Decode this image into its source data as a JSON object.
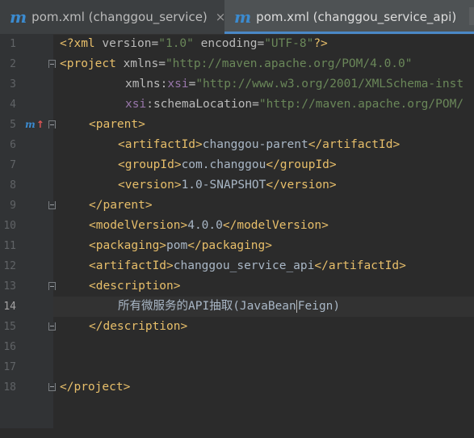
{
  "tabs": [
    {
      "label": "pom.xml (changgou_service)",
      "icon": "maven-icon",
      "close": "×",
      "active": false
    },
    {
      "label": "pom.xml (changgou_service_api)",
      "icon": "maven-icon",
      "active": true
    }
  ],
  "gutter": {
    "line_numbers": [
      "1",
      "2",
      "3",
      "4",
      "5",
      "6",
      "7",
      "8",
      "9",
      "10",
      "11",
      "12",
      "13",
      "14",
      "15",
      "16",
      "17",
      "18"
    ],
    "current_line": "14",
    "maven_marker": {
      "label": "m",
      "arrow": "↑"
    }
  },
  "code": {
    "l1": {
      "open": "<?xml",
      "a1": " version=",
      "v1": "\"1.0\"",
      "a2": " encoding=",
      "v2": "\"UTF-8\"",
      "close": "?>"
    },
    "l2": {
      "tag": "<project",
      "a": " xmlns=",
      "v": "\"http://maven.apache.org/POM/4.0.0\""
    },
    "l3": {
      "ns": "xmlns",
      "colon": ":",
      "attr": "xsi",
      "eq": "=",
      "v": "\"http://www.w3.org/2001/XMLSchema-inst"
    },
    "l4": {
      "ns": "xsi",
      "colon": ":",
      "attr": "schemaLocation",
      "eq": "=",
      "v": "\"http://maven.apache.org/POM/"
    },
    "l5": {
      "tag": "<parent>"
    },
    "l6": {
      "open": "<artifactId>",
      "text": "changgou-parent",
      "close": "</artifactId>"
    },
    "l7": {
      "open": "<groupId>",
      "text": "com.changgou",
      "close": "</groupId>"
    },
    "l8": {
      "open": "<version>",
      "text": "1.0-SNAPSHOT",
      "close": "</version>"
    },
    "l9": {
      "tag": "</parent>"
    },
    "l10": {
      "open": "<modelVersion>",
      "text": "4.0.0",
      "close": "</modelVersion>"
    },
    "l11": {
      "open": "<packaging>",
      "text": "pom",
      "close": "</packaging>"
    },
    "l12": {
      "open": "<artifactId>",
      "text": "changgou_service_api",
      "close": "</artifactId>"
    },
    "l13": {
      "tag": "<description>"
    },
    "l14": {
      "before_cursor": "所有微服务的API抽取(JavaBean",
      "after_cursor": "Feign)"
    },
    "l15": {
      "tag": "</description>"
    },
    "l18": {
      "tag": "</project>"
    }
  },
  "colors": {
    "background": "#2b2b2b",
    "gutter": "#313335",
    "tag": "#e8bf6a",
    "string": "#6a8759",
    "namespace": "#9876aa",
    "text": "#a9b7c6",
    "maven_blue": "#3b8bd0",
    "active_tab_underline": "#4a88c7"
  }
}
